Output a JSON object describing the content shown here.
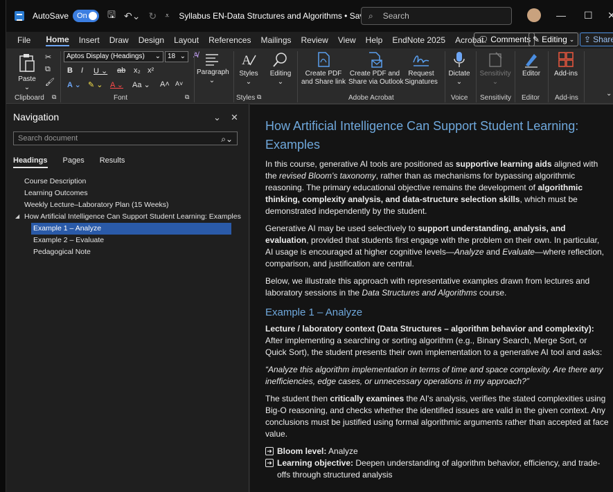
{
  "titlebar": {
    "autosave_label": "AutoSave",
    "autosave_state": "On",
    "doc_title": "Syllabus EN-Data Structures and Algorithms • Saved ⌄",
    "search_placeholder": "Search"
  },
  "menu": {
    "items": [
      "File",
      "Home",
      "Insert",
      "Draw",
      "Design",
      "Layout",
      "References",
      "Mailings",
      "Review",
      "View",
      "Help",
      "EndNote 2025",
      "Acrobat"
    ],
    "active": "Home",
    "comments_label": "Comments",
    "editing_label": "Editing",
    "share_label": "Share"
  },
  "ribbon": {
    "paste_label": "Paste",
    "clipboard_label": "Clipboard",
    "font_name": "Aptos Display (Headings)",
    "font_size": "18",
    "font_label": "Font",
    "paragraph_label": "Paragraph",
    "styles_btn_label": "Styles",
    "styles_label": "Styles",
    "editing_btn_label": "Editing",
    "create_pdf_line1": "Create PDF",
    "create_pdf_line2": "and Share link",
    "create_pdf_outlook_line1": "Create PDF and",
    "create_pdf_outlook_line2": "Share via Outlook",
    "request_line1": "Request",
    "request_line2": "Signatures",
    "adobe_label": "Adobe Acrobat",
    "dictate_label": "Dictate",
    "voice_label": "Voice",
    "sensitivity_btn_label": "Sensitivity",
    "sensitivity_label": "Sensitivity",
    "editor_btn_label": "Editor",
    "editor_label": "Editor",
    "addins_btn_label": "Add-ins",
    "addins_label": "Add-ins"
  },
  "navigation": {
    "title": "Navigation",
    "search_placeholder": "Search document",
    "tabs": [
      "Headings",
      "Pages",
      "Results"
    ],
    "headings": [
      {
        "text": "Course Description",
        "level": 1
      },
      {
        "text": "Learning Outcomes",
        "level": 1
      },
      {
        "text": "Weekly Lecture–Laboratory Plan (15 Weeks)",
        "level": 1
      },
      {
        "text": "How Artificial Intelligence Can Support Student Learning: Examples",
        "level": 1
      },
      {
        "text": "Example 1 – Analyze",
        "level": 2
      },
      {
        "text": "Example 2 – Evaluate",
        "level": 2
      },
      {
        "text": "Pedagogical Note",
        "level": 2
      }
    ]
  },
  "document": {
    "heading": "How Artificial Intelligence Can Support Student Learning: Examples",
    "p1": {
      "a": "In this course, generative AI tools are positioned as ",
      "b": "supportive learning aids",
      "c": " aligned with the ",
      "d": "revised Bloom's taxonomy",
      "e": ", rather than as mechanisms for bypassing algorithmic reasoning. The primary educational objective remains the development of ",
      "f": "algorithmic thinking, complexity analysis, and data-structure selection skills",
      "g": ", which must be demonstrated independently by the student."
    },
    "p2": {
      "a": "Generative AI may be used selectively to ",
      "b": "support understanding, analysis, and evaluation",
      "c": ", provided that students first engage with the problem on their own. In particular, AI usage is encouraged at higher cognitive levels—",
      "d": "Analyze",
      "e": " and ",
      "f": "Evaluate",
      "g": "—where reflection, comparison, and justification are central."
    },
    "p3": {
      "a": "Below, we illustrate this approach with representative examples drawn from lectures and laboratory sessions in the ",
      "b": "Data Structures and Algorithms",
      "c": " course."
    },
    "example1_heading": "Example 1 – Analyze",
    "context_label": "Lecture / laboratory context (Data Structures – algorithm behavior and complexity):",
    "context_text": "After implementing a searching or sorting algorithm (e.g., Binary Search, Merge Sort, or Quick Sort), the student presents their own implementation to a generative AI tool and asks:",
    "quote": "“Analyze this algorithm implementation in terms of time and space complexity. Are there any inefficiencies, edge cases, or unnecessary operations in my approach?”",
    "p4": {
      "a": "The student then ",
      "b": "critically examines",
      "c": " the AI's analysis, verifies the stated complexities using Big-O reasoning, and checks whether the identified issues are valid in the given context. Any conclusions must be justified using formal algorithmic arguments rather than accepted at face value."
    },
    "bloom_label": "Bloom level:",
    "bloom_value": " Analyze",
    "objective_label": "Learning objective:",
    "objective_value": " Deepen understanding of algorithm behavior, efficiency, and trade-offs through structured analysis"
  }
}
